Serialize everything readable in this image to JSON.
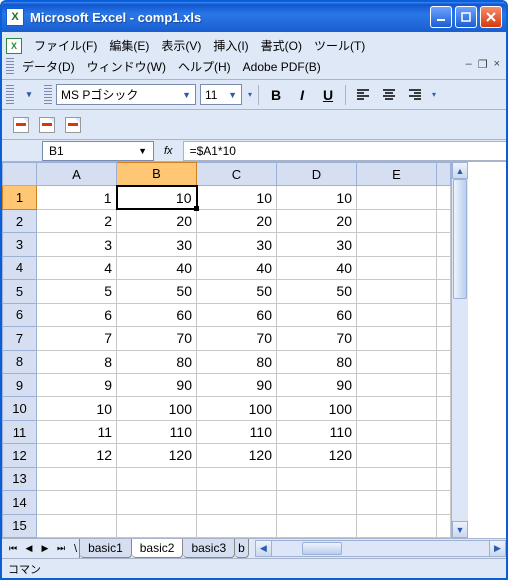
{
  "titlebar": {
    "title": "Microsoft Excel - comp1.xls"
  },
  "menu": {
    "file": "ファイル(F)",
    "edit": "編集(E)",
    "view": "表示(V)",
    "insert": "挿入(I)",
    "format": "書式(O)",
    "tools": "ツール(T)",
    "data": "データ(D)",
    "window": "ウィンドウ(W)",
    "help": "ヘルプ(H)",
    "adobe": "Adobe PDF(B)"
  },
  "toolbar": {
    "font_name": "MS Pゴシック",
    "font_size": "11",
    "bold": "B",
    "italic": "I",
    "underline": "U"
  },
  "formula_bar": {
    "name_box": "B1",
    "fx_label": "fx",
    "formula": "=$A1*10"
  },
  "columns": [
    "A",
    "B",
    "C",
    "D",
    "E"
  ],
  "row_count": 15,
  "selected_cell": "B1",
  "cells": {
    "r1": {
      "A": "1",
      "B": "10",
      "C": "10",
      "D": "10"
    },
    "r2": {
      "A": "2",
      "B": "20",
      "C": "20",
      "D": "20"
    },
    "r3": {
      "A": "3",
      "B": "30",
      "C": "30",
      "D": "30"
    },
    "r4": {
      "A": "4",
      "B": "40",
      "C": "40",
      "D": "40"
    },
    "r5": {
      "A": "5",
      "B": "50",
      "C": "50",
      "D": "50"
    },
    "r6": {
      "A": "6",
      "B": "60",
      "C": "60",
      "D": "60"
    },
    "r7": {
      "A": "7",
      "B": "70",
      "C": "70",
      "D": "70"
    },
    "r8": {
      "A": "8",
      "B": "80",
      "C": "80",
      "D": "80"
    },
    "r9": {
      "A": "9",
      "B": "90",
      "C": "90",
      "D": "90"
    },
    "r10": {
      "A": "10",
      "B": "100",
      "C": "100",
      "D": "100"
    },
    "r11": {
      "A": "11",
      "B": "110",
      "C": "110",
      "D": "110"
    },
    "r12": {
      "A": "12",
      "B": "120",
      "C": "120",
      "D": "120"
    }
  },
  "tabs": {
    "t1": "basic1",
    "t2": "basic2",
    "t3": "basic3",
    "t4": "b"
  },
  "statusbar": {
    "text": "コマン"
  }
}
